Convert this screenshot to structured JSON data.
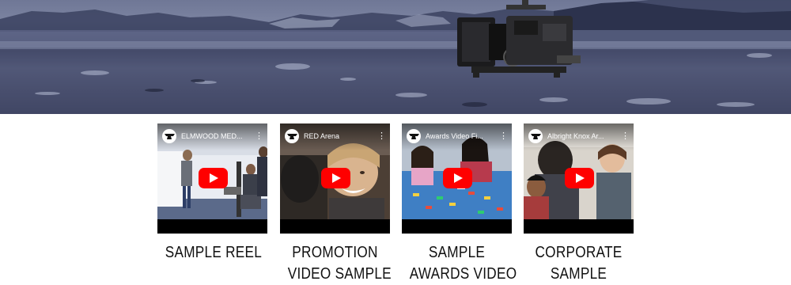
{
  "hero": {
    "image": "glacier-lagoon-landscape",
    "product": "cinema-camera-rig"
  },
  "videos": [
    {
      "title": "ELMWOOD MED...",
      "caption_line1": "SAMPLE REEL",
      "caption_line2": "",
      "scene": "classroom-presentation",
      "channel_icon": "anvil-icon"
    },
    {
      "title": "RED Arena",
      "caption_line1": "PROMOTION",
      "caption_line2": "VIDEO SAMPLE",
      "scene": "smiling-woman",
      "channel_icon": "anvil-icon"
    },
    {
      "title": "Awards Video Fi...",
      "caption_line1": "SAMPLE",
      "caption_line2": "AWARDS VIDEO",
      "scene": "kids-building-blocks",
      "channel_icon": "anvil-icon"
    },
    {
      "title": "Albright Knox Ar...",
      "caption_line1": "CORPORATE",
      "caption_line2": "SAMPLE",
      "scene": "children-in-gallery",
      "channel_icon": "anvil-icon"
    }
  ],
  "colors": {
    "play_button": "#ff0000",
    "caption_text": "#111111",
    "thumb_bar": "#000000"
  }
}
